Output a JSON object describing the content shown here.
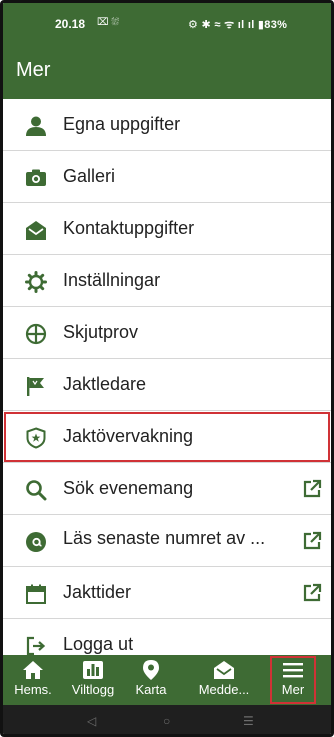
{
  "status_bar": {
    "time": "20.18",
    "left_icons": "⌧ ⛆",
    "right_icons": "⚙ ✱ ≈ ᯤ ıl ıl ▮83%"
  },
  "header": {
    "title": "Mer"
  },
  "menu": [
    {
      "label": "Egna uppgifter",
      "icon": "person-icon"
    },
    {
      "label": "Galleri",
      "icon": "camera-icon"
    },
    {
      "label": "Kontaktuppgifter",
      "icon": "envelope-open-icon"
    },
    {
      "label": "Inställningar",
      "icon": "gear-icon"
    },
    {
      "label": "Skjutprov",
      "icon": "crosshair-icon"
    },
    {
      "label": "Jaktledare",
      "icon": "flag-icon"
    },
    {
      "label": "Jaktövervakning",
      "icon": "shield-star-icon"
    },
    {
      "label": "Sök evenemang",
      "icon": "search-icon"
    },
    {
      "label": "Läs senaste numret av ...",
      "icon": "at-icon"
    },
    {
      "label": "Jakttider",
      "icon": "calendar-icon"
    },
    {
      "label": "Logga ut",
      "icon": "logout-icon"
    }
  ],
  "bottom_nav": [
    {
      "label": "Hems.",
      "icon": "home-icon"
    },
    {
      "label": "Viltlogg",
      "icon": "chart-icon"
    },
    {
      "label": "Karta",
      "icon": "map-pin-icon"
    },
    {
      "label": "Medde...",
      "icon": "envelope-open-icon"
    },
    {
      "label": "Mer",
      "icon": "menu-icon"
    }
  ],
  "system_nav": {
    "back": "◁",
    "home": "○",
    "recents": "☰"
  },
  "colors": {
    "brand_green": "#3e6b34",
    "highlight_red": "#d03236",
    "system_bar": "#1f1f1f"
  }
}
